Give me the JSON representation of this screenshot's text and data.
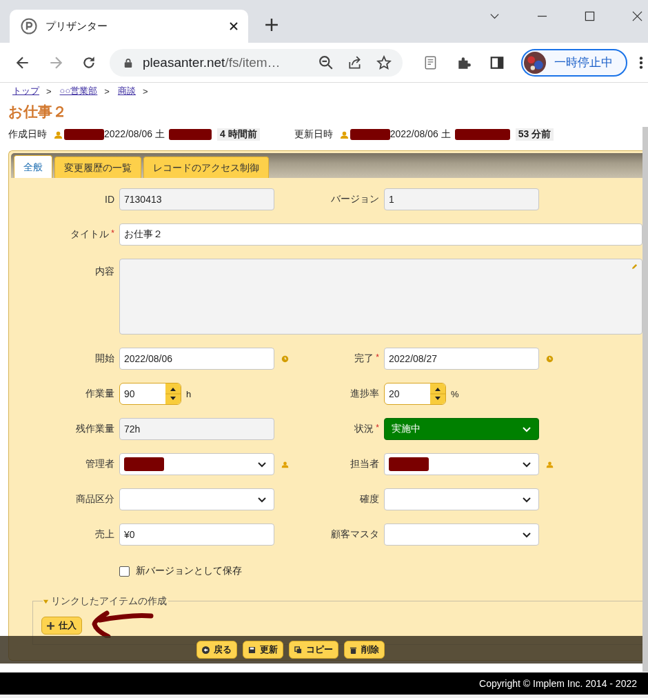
{
  "browser": {
    "tab_title": "プリザンター",
    "host": "pleasanter.net",
    "path": "/fs/item…",
    "profile_label": "一時停止中"
  },
  "breadcrumb": [
    {
      "label": "トップ",
      "separator": ">"
    },
    {
      "label": "○○営業部",
      "separator": ">"
    },
    {
      "label": "商談",
      "separator": ">"
    }
  ],
  "title": "お仕事２",
  "meta": [
    {
      "label": "作成日時",
      "date": "2022/08/06 土",
      "ago": "4 時間前"
    },
    {
      "label": "更新日時",
      "date": "2022/08/06 土",
      "ago": "53 分前"
    }
  ],
  "tabs": [
    {
      "label": "全般",
      "selected": true
    },
    {
      "label": "変更履歴の一覧",
      "selected": false
    },
    {
      "label": "レコードのアクセス制御",
      "selected": false
    }
  ],
  "rows": [
    [
      {
        "kind": "readonly",
        "label": "ID",
        "value": "7130413"
      },
      {
        "kind": "readonly",
        "label": "バージョン",
        "value": "1"
      }
    ],
    [
      {
        "kind": "text",
        "label": "タイトル",
        "required": "*",
        "value": "お仕事２",
        "wide": true
      }
    ],
    [
      {
        "kind": "textarea",
        "label": "内容",
        "wide": true
      }
    ],
    [
      {
        "kind": "date",
        "label": "開始",
        "value": "2022/08/06"
      },
      {
        "kind": "date",
        "label": "完了",
        "required": "*",
        "value": "2022/08/27"
      }
    ],
    [
      {
        "kind": "spinner",
        "label": "作業量",
        "value": "90",
        "unit": "h"
      },
      {
        "kind": "spinner",
        "label": "進捗率",
        "value": "20",
        "unit": "%"
      }
    ],
    [
      {
        "kind": "readonly",
        "label": "残作業量",
        "value": "72h"
      },
      {
        "kind": "select",
        "label": "状況",
        "required": "*",
        "value": "実施中",
        "color": "#008000"
      }
    ],
    [
      {
        "kind": "user-select",
        "label": "管理者",
        "redacted": true
      },
      {
        "kind": "user-select",
        "label": "担当者",
        "redacted": true
      }
    ],
    [
      {
        "kind": "select",
        "label": "商品区分"
      },
      {
        "kind": "select",
        "label": "確度"
      }
    ],
    [
      {
        "kind": "text",
        "label": "売上",
        "value": "¥0"
      },
      {
        "kind": "select",
        "label": "顧客マスタ"
      }
    ]
  ],
  "save_as_new_version": {
    "label": "新バージョンとして保存",
    "checked": false
  },
  "linked_items": {
    "legend": "リンクしたアイテムの作成",
    "expanded": true,
    "buttons": [
      {
        "label": "仕入"
      }
    ]
  },
  "commands": [
    {
      "kind": "back",
      "label": "戻る"
    },
    {
      "kind": "save",
      "label": "更新"
    },
    {
      "kind": "copy",
      "label": "コピー"
    },
    {
      "kind": "delete",
      "label": "削除"
    }
  ],
  "footer": "Copyright © Implem Inc. 2014 - 2022"
}
